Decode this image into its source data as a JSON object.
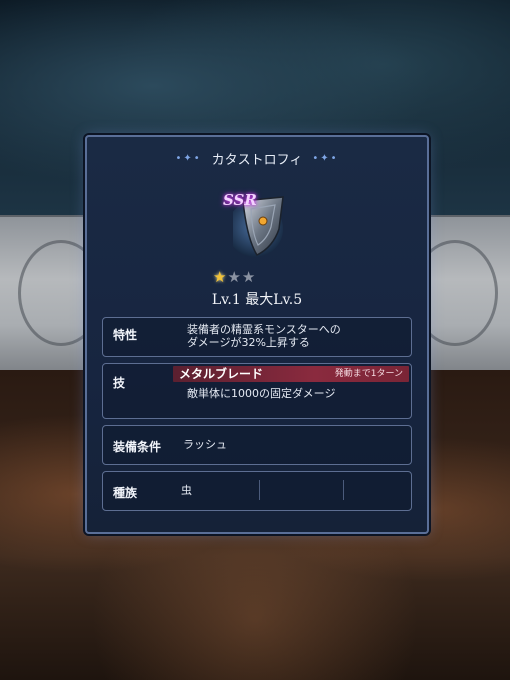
{
  "panel": {
    "title": "カタストロフィ",
    "rarity": "SSR",
    "stars": {
      "filled": 1,
      "total": 3
    },
    "level_text": "Lv.1  最大Lv.5"
  },
  "traits": {
    "label": "特性",
    "lines": [
      "装備者の精霊系モンスターへの",
      "ダメージが32%上昇する"
    ]
  },
  "skill": {
    "label": "技",
    "name": "メタルブレード",
    "cooldown": "発動まで1ターン",
    "description": "敵単体に1000の固定ダメージ"
  },
  "equip_condition": {
    "label": "装備条件",
    "value": "ラッシュ"
  },
  "species": {
    "label": "種族",
    "value": "虫"
  },
  "colors": {
    "accent": "#5a6f98",
    "skill_bar": "#8a2a3e",
    "star": "#f0c23a"
  },
  "icons": {
    "item": "shield-icon",
    "star": "star-icon"
  }
}
